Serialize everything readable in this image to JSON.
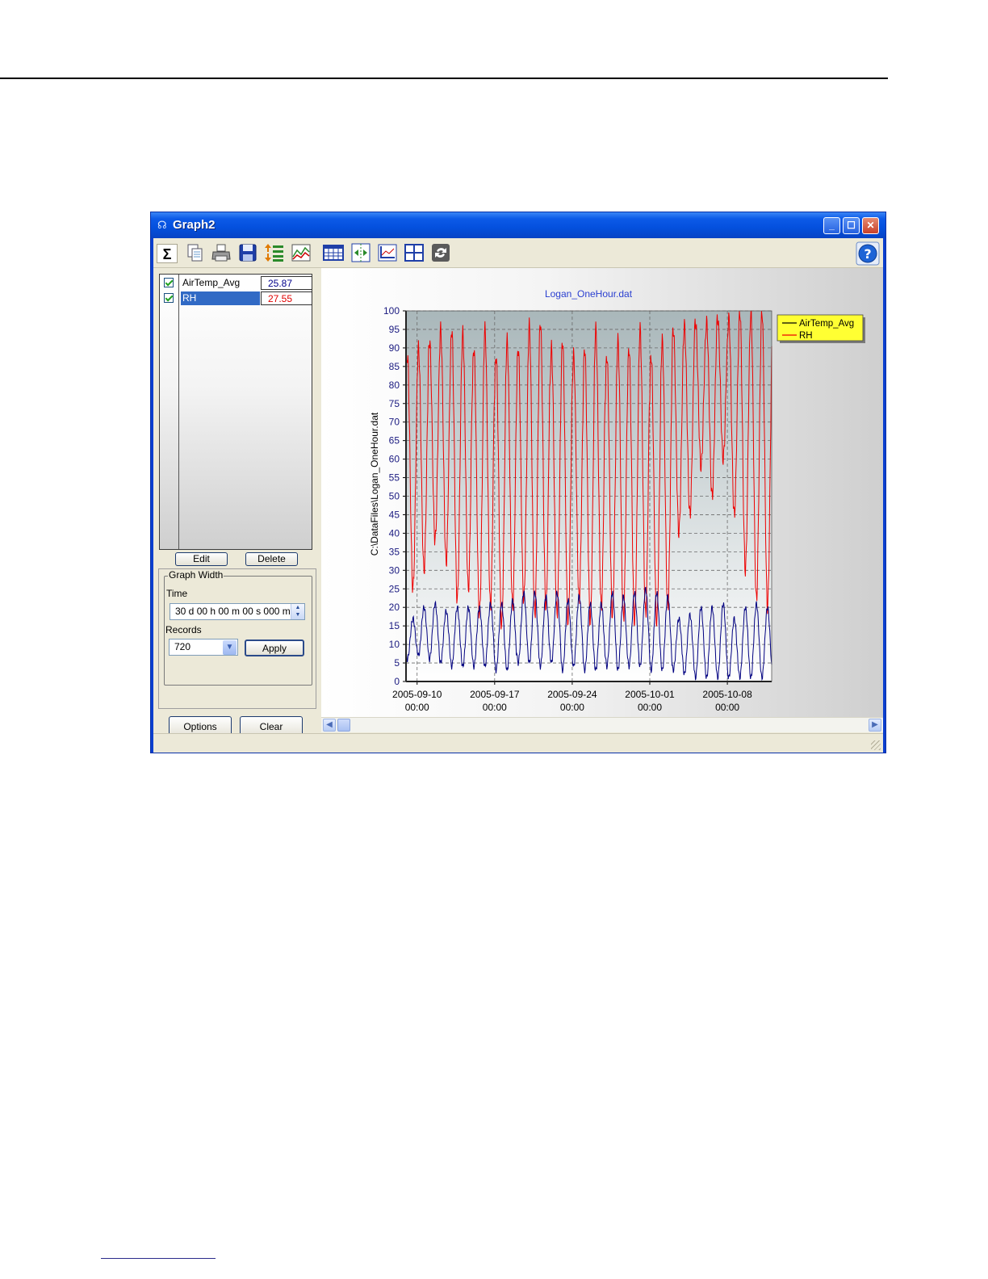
{
  "window": {
    "title": "Graph2"
  },
  "toolbar": {
    "sigma_label": "Σ",
    "icons": [
      "copy-icon",
      "print-icon",
      "save-icon",
      "sort-icon",
      "chart-icon",
      "table-icon",
      "zoom-icon",
      "axis-icon",
      "grid-icon",
      "refresh-icon",
      "help-icon"
    ]
  },
  "traces": [
    {
      "name": "AirTemp_Avg",
      "value": "25.87",
      "value_color": "#00008b",
      "checked": true
    },
    {
      "name": "RH",
      "value": "27.55",
      "value_color": "#e00000",
      "checked": true
    }
  ],
  "buttons": {
    "edit": "Edit",
    "delete": "Delete",
    "apply": "Apply",
    "options": "Options",
    "clear": "Clear"
  },
  "graph_width": {
    "legend": "Graph Width",
    "time_label": "Time",
    "time_value": "30 d 00 h 00 m 00 s 000 ms",
    "records_label": "Records",
    "records_value": "720"
  },
  "chart_data": {
    "type": "line",
    "title": "Logan_OneHour.dat",
    "ylabel": "C:\\DataFiles\\Logan_OneHour.dat",
    "xlabel": "",
    "ylim": [
      0,
      100
    ],
    "yticks": [
      0,
      5,
      10,
      15,
      20,
      25,
      30,
      35,
      40,
      45,
      50,
      55,
      60,
      65,
      70,
      75,
      80,
      85,
      90,
      95,
      100
    ],
    "xlim": [
      "2005-09-09T00:00",
      "2005-10-12T00:00"
    ],
    "xticks": [
      {
        "date": "2005-09-10",
        "time": "00:00"
      },
      {
        "date": "2005-09-17",
        "time": "00:00"
      },
      {
        "date": "2005-09-24",
        "time": "00:00"
      },
      {
        "date": "2005-10-01",
        "time": "00:00"
      },
      {
        "date": "2005-10-08",
        "time": "00:00"
      }
    ],
    "grid": true,
    "legend_position": "top-right",
    "start": "2005-09-09T00:00",
    "series": [
      {
        "name": "AirTemp_Avg",
        "color": "#000080",
        "legend_color": "#000000",
        "daily_max": [
          17,
          20,
          21,
          19,
          20,
          20,
          20,
          21,
          21,
          22,
          24,
          24,
          23,
          24,
          22,
          23,
          21,
          21,
          24,
          23,
          24,
          25,
          24,
          23,
          17,
          18,
          20,
          20,
          21,
          17,
          20,
          21,
          20
        ],
        "daily_min": [
          6,
          7,
          6,
          5,
          4,
          4,
          4,
          4,
          3,
          3,
          5,
          5,
          4,
          5,
          3,
          4,
          3,
          3,
          4,
          3,
          4,
          4,
          3,
          3,
          3,
          2,
          1,
          1,
          1,
          1,
          1,
          1,
          1
        ]
      },
      {
        "name": "RH",
        "color": "#ee0000",
        "legend_color": "#ee0000",
        "daily_max": [
          88,
          90,
          92,
          95,
          95,
          94,
          90,
          95,
          88,
          92,
          90,
          96,
          97,
          90,
          92,
          88,
          90,
          95,
          88,
          92,
          90,
          95,
          88,
          92,
          95,
          96,
          97,
          97,
          98,
          98,
          100,
          100,
          100
        ],
        "daily_min": [
          25,
          30,
          38,
          32,
          22,
          25,
          18,
          20,
          15,
          20,
          22,
          18,
          20,
          18,
          16,
          22,
          16,
          20,
          18,
          17,
          16,
          18,
          16,
          20,
          40,
          45,
          58,
          50,
          60,
          45,
          30,
          22,
          20
        ]
      }
    ]
  }
}
